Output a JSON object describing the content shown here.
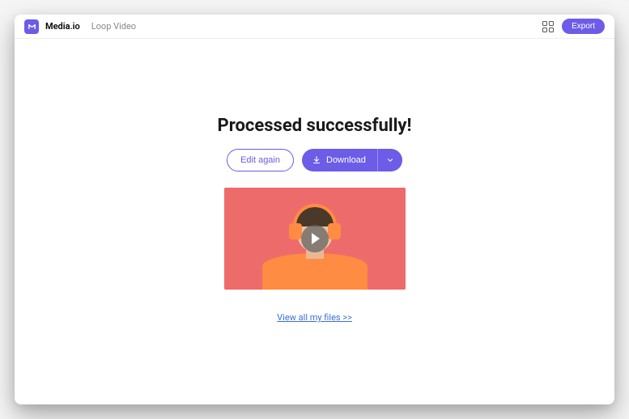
{
  "header": {
    "brand": "Media.io",
    "breadcrumb": "Loop Video",
    "export_label": "Export"
  },
  "main": {
    "title": "Processed successfully!",
    "edit_label": "Edit again",
    "download_label": "Download",
    "files_link": "View all my files >>"
  }
}
